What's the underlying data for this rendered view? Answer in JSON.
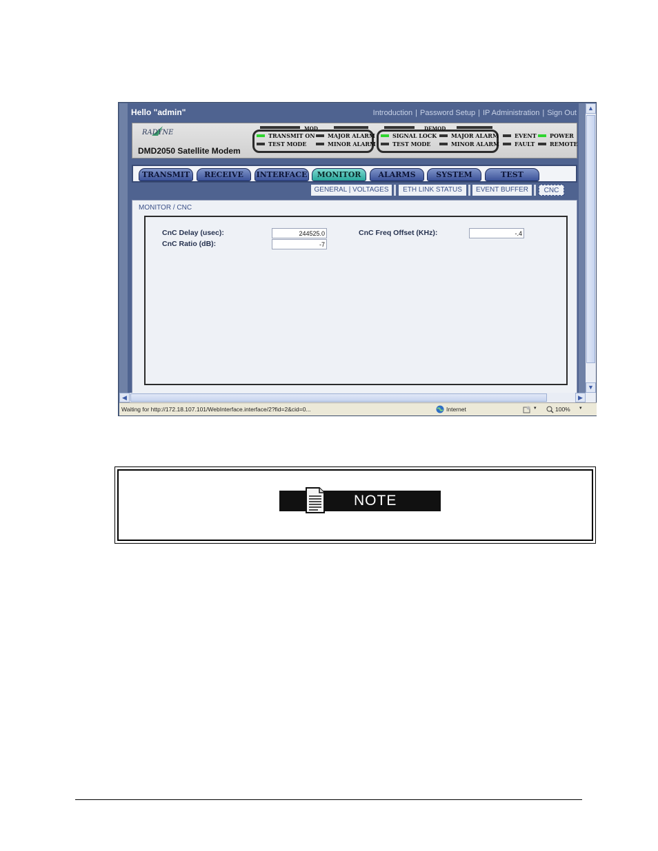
{
  "browser": {
    "greeting": "Hello \"admin\"",
    "top_links": [
      "Introduction",
      "Password Setup",
      "IP Administration",
      "Sign Out"
    ],
    "status_url": "Waiting for http://172.18.107.101/WebInterface.interface/2?fid=2&cid=0...",
    "zone": "Internet",
    "zoom": "100%"
  },
  "header": {
    "brand": "RADYNE",
    "model": "DMD2050 Satellite Modem",
    "mod": {
      "label": "MOD",
      "indicators": [
        {
          "label": "TRANSMIT ON",
          "color": "#2fd52f"
        },
        {
          "label": "TEST MODE",
          "color": "#333333"
        },
        {
          "label": "MAJOR ALARM",
          "color": "#333333"
        },
        {
          "label": "MINOR ALARM",
          "color": "#333333"
        }
      ]
    },
    "demod": {
      "label": "DEMOD",
      "indicators": [
        {
          "label": "SIGNAL LOCK",
          "color": "#2fd52f"
        },
        {
          "label": "TEST MODE",
          "color": "#333333"
        },
        {
          "label": "MAJOR ALARM",
          "color": "#333333"
        },
        {
          "label": "MINOR ALARM",
          "color": "#333333"
        }
      ]
    },
    "system_indicators": [
      {
        "label": "EVENT",
        "color": "#333333"
      },
      {
        "label": "FAULT",
        "color": "#333333"
      },
      {
        "label": "POWER",
        "color": "#2fd52f"
      },
      {
        "label": "REMOTE",
        "color": "#333333"
      }
    ]
  },
  "nav": {
    "tabs": [
      "TRANSMIT",
      "RECEIVE",
      "INTERFACE",
      "MONITOR",
      "ALARMS",
      "SYSTEM",
      "TEST"
    ],
    "active": "MONITOR"
  },
  "subnav": {
    "tabs": [
      "GENERAL | VOLTAGES",
      "ETH LINK STATUS",
      "EVENT BUFFER",
      "CNC"
    ],
    "active": "CNC"
  },
  "content": {
    "breadcrumb": "MONITOR / CNC",
    "fields": [
      {
        "label": "CnC Delay (usec):",
        "value": "244525.0"
      },
      {
        "label": "CnC Ratio (dB):",
        "value": "-7"
      },
      {
        "label": "CnC Freq Offset (KHz):",
        "value": "-.4"
      }
    ]
  },
  "note": {
    "title": "NOTE"
  },
  "colors": {
    "active_tab": "#2aa89c",
    "led_on": "#2fd52f"
  }
}
